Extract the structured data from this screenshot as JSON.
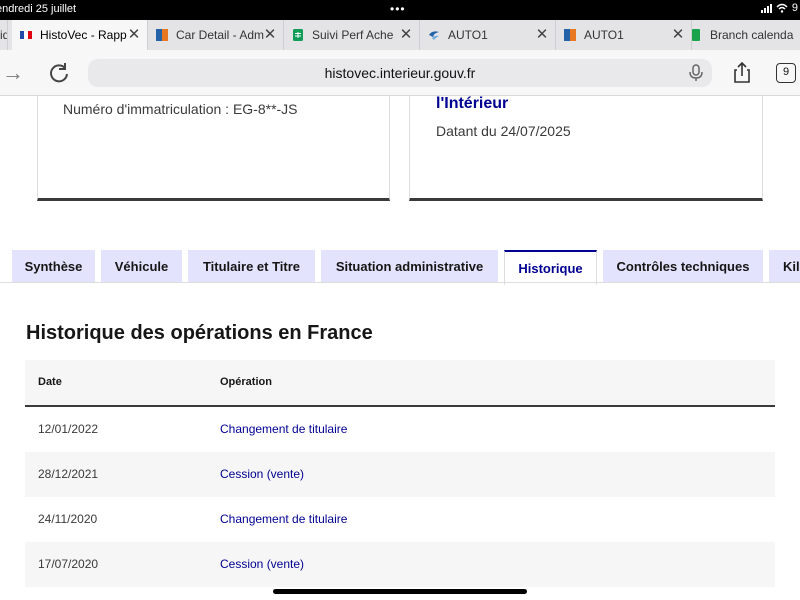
{
  "status_bar": {
    "datetime": "endredi 25 juillet",
    "dots": "•••",
    "battery": "9"
  },
  "browser_tabs": [
    {
      "title": "ide",
      "favicon": "partial-tab",
      "color": "#e4e4e6"
    },
    {
      "title": "HistoVec - Rapp",
      "favicon": "french-flag-icon",
      "color": "#1f4aa8"
    },
    {
      "title": "Car Detail - Adm",
      "favicon": "blue-orange-square-icon",
      "color": "#e87722"
    },
    {
      "title": "Suivi Perf Ache",
      "favicon": "google-sheets-icon",
      "color": "#0f9d58"
    },
    {
      "title": "AUTO1",
      "favicon": "auto1-swirl-icon",
      "color": "#2563a8"
    },
    {
      "title": "AUTO1",
      "favicon": "blue-orange-square-icon",
      "color": "#e87722"
    },
    {
      "title": "Branch calenda",
      "favicon": "green-doc-icon",
      "color": "#19a34a"
    }
  ],
  "address_bar": {
    "url": "histovec.interieur.gouv.fr",
    "tab_count": "9"
  },
  "cards": {
    "left_plate": "Numéro d'immatriculation : EG-8**-JS",
    "right_org": "l'Intérieur",
    "right_date": "Datant du 24/07/2025"
  },
  "page_tabs": [
    {
      "label": "Synthèse",
      "active": false
    },
    {
      "label": "Véhicule",
      "active": false
    },
    {
      "label": "Titulaire et Titre",
      "active": false
    },
    {
      "label": "Situation administrative",
      "active": false
    },
    {
      "label": "Historique",
      "active": true
    },
    {
      "label": "Contrôles techniques",
      "active": false
    },
    {
      "label": "Kilo",
      "active": false
    }
  ],
  "section": {
    "title": "Historique des opérations en France"
  },
  "table": {
    "columns": [
      "Date",
      "Opération"
    ],
    "rows": [
      {
        "date": "12/01/2022",
        "operation": "Changement de titulaire"
      },
      {
        "date": "28/12/2021",
        "operation": "Cession (vente)"
      },
      {
        "date": "24/11/2020",
        "operation": "Changement de titulaire"
      },
      {
        "date": "17/07/2020",
        "operation": "Cession (vente)"
      }
    ]
  },
  "colors": {
    "accent": "#000091",
    "tab_bg": "#e3e3fd",
    "row_alt": "#f6f6f6"
  }
}
